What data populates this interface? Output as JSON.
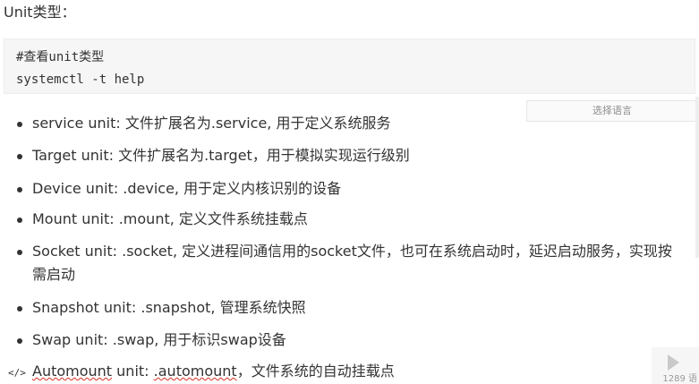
{
  "heading": "Unit类型：",
  "code": {
    "comment": "#查看unit类型",
    "command": "systemctl -t help"
  },
  "language_selector": {
    "label": "选择语言"
  },
  "units": [
    {
      "name": "service unit",
      "desc": ": 文件扩展名为.service, 用于定义系统服务"
    },
    {
      "name": "Target unit",
      "desc": ": 文件扩展名为.target，用于模拟实现运行级别"
    },
    {
      "name": "Device unit",
      "desc": ": .device, 用于定义内核识别的设备"
    },
    {
      "name": "Mount unit",
      "desc": ": .mount, 定义文件系统挂载点"
    },
    {
      "name": "Socket unit",
      "desc": ": .socket, 定义进程间通信用的socket文件，也可在系统启动时，延迟启动服务，实现按",
      "desc_line2": "需启动"
    },
    {
      "name": "Snapshot unit",
      "desc": ": .snapshot, 管理系统快照"
    },
    {
      "name": "Swap unit",
      "desc": ": .swap, 用于标识swap设备"
    },
    {
      "name_a": "Automount",
      "name_b": " unit",
      "desc_a": ": ",
      "desc_b": ".automount",
      "desc_c": "，文件系统的自动挂载点"
    }
  ],
  "code_tag_icon": "</>",
  "video_widget": {
    "count": "1289 语"
  }
}
